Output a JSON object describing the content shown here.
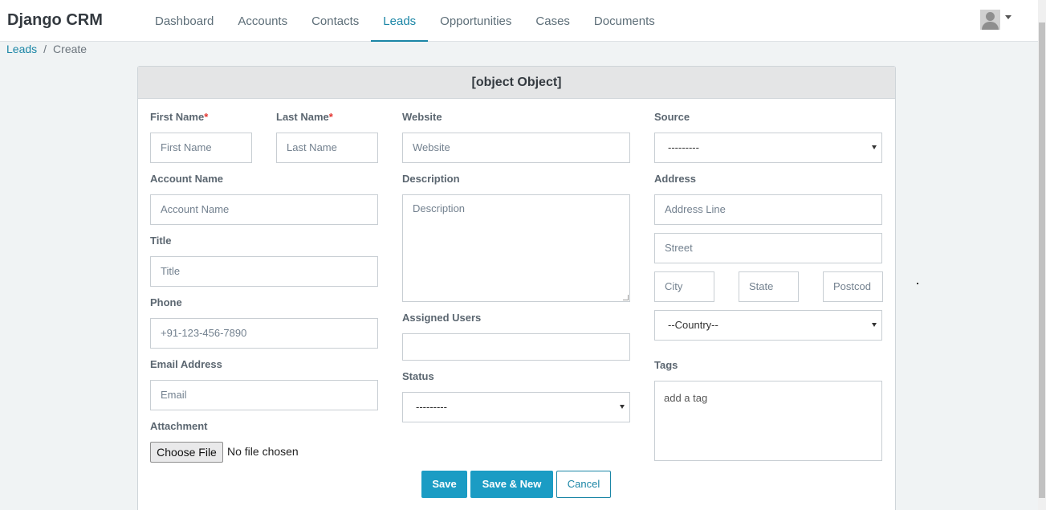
{
  "navbar": {
    "brand": "Django CRM",
    "items": [
      "Dashboard",
      "Accounts",
      "Contacts",
      "Leads",
      "Opportunities",
      "Cases",
      "Documents"
    ],
    "active": "Leads"
  },
  "breadcrumb": {
    "parent": "Leads",
    "current": "Create"
  },
  "form": {
    "title": {
      "label": "Title",
      "placeholder": "Title"
    },
    "first_name": {
      "label": "First Name",
      "placeholder": "First Name",
      "required": "*"
    },
    "last_name": {
      "label": "Last Name",
      "placeholder": "Last Name",
      "required": "*"
    },
    "account_name": {
      "label": "Account Name",
      "placeholder": "Account Name"
    },
    "phone": {
      "label": "Phone",
      "placeholder": "+91-123-456-7890"
    },
    "email": {
      "label": "Email Address",
      "placeholder": "Email"
    },
    "attachment": {
      "label": "Attachment",
      "button": "Choose File",
      "status": "No file chosen"
    },
    "website": {
      "label": "Website",
      "placeholder": "Website"
    },
    "description": {
      "label": "Description",
      "placeholder": "Description"
    },
    "assigned_users": {
      "label": "Assigned Users",
      "value": ""
    },
    "status": {
      "label": "Status",
      "value": "---------"
    },
    "source": {
      "label": "Source",
      "value": "---------"
    },
    "address": {
      "label": "Address",
      "line_placeholder": "Address Line",
      "street_placeholder": "Street",
      "city_placeholder": "City",
      "state_placeholder": "State",
      "postcode_placeholder": "Postcod",
      "country_value": "--Country--"
    },
    "tags": {
      "label": "Tags",
      "placeholder": "add a tag"
    },
    "buttons": {
      "save": "Save",
      "save_new": "Save & New",
      "cancel": "Cancel"
    }
  },
  "colors": {
    "accent": "#1b9cc4",
    "link": "#1b86a6",
    "required": "#e3342f"
  }
}
